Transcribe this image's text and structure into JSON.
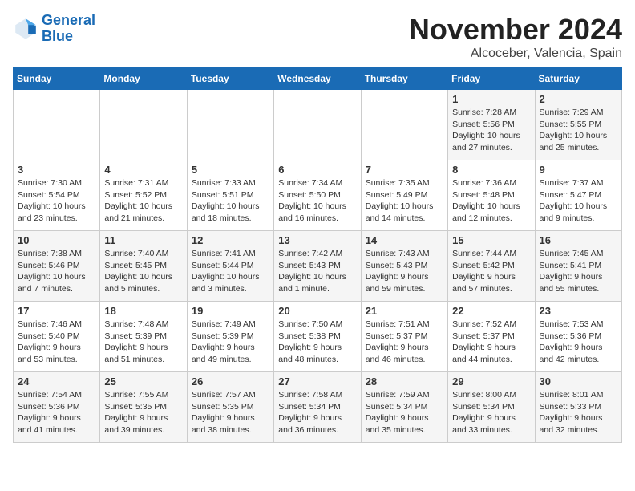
{
  "header": {
    "logo_line1": "General",
    "logo_line2": "Blue",
    "month": "November 2024",
    "location": "Alcoceber, Valencia, Spain"
  },
  "weekdays": [
    "Sunday",
    "Monday",
    "Tuesday",
    "Wednesday",
    "Thursday",
    "Friday",
    "Saturday"
  ],
  "weeks": [
    [
      {
        "day": "",
        "info": ""
      },
      {
        "day": "",
        "info": ""
      },
      {
        "day": "",
        "info": ""
      },
      {
        "day": "",
        "info": ""
      },
      {
        "day": "",
        "info": ""
      },
      {
        "day": "1",
        "info": "Sunrise: 7:28 AM\nSunset: 5:56 PM\nDaylight: 10 hours\nand 27 minutes."
      },
      {
        "day": "2",
        "info": "Sunrise: 7:29 AM\nSunset: 5:55 PM\nDaylight: 10 hours\nand 25 minutes."
      }
    ],
    [
      {
        "day": "3",
        "info": "Sunrise: 7:30 AM\nSunset: 5:54 PM\nDaylight: 10 hours\nand 23 minutes."
      },
      {
        "day": "4",
        "info": "Sunrise: 7:31 AM\nSunset: 5:52 PM\nDaylight: 10 hours\nand 21 minutes."
      },
      {
        "day": "5",
        "info": "Sunrise: 7:33 AM\nSunset: 5:51 PM\nDaylight: 10 hours\nand 18 minutes."
      },
      {
        "day": "6",
        "info": "Sunrise: 7:34 AM\nSunset: 5:50 PM\nDaylight: 10 hours\nand 16 minutes."
      },
      {
        "day": "7",
        "info": "Sunrise: 7:35 AM\nSunset: 5:49 PM\nDaylight: 10 hours\nand 14 minutes."
      },
      {
        "day": "8",
        "info": "Sunrise: 7:36 AM\nSunset: 5:48 PM\nDaylight: 10 hours\nand 12 minutes."
      },
      {
        "day": "9",
        "info": "Sunrise: 7:37 AM\nSunset: 5:47 PM\nDaylight: 10 hours\nand 9 minutes."
      }
    ],
    [
      {
        "day": "10",
        "info": "Sunrise: 7:38 AM\nSunset: 5:46 PM\nDaylight: 10 hours\nand 7 minutes."
      },
      {
        "day": "11",
        "info": "Sunrise: 7:40 AM\nSunset: 5:45 PM\nDaylight: 10 hours\nand 5 minutes."
      },
      {
        "day": "12",
        "info": "Sunrise: 7:41 AM\nSunset: 5:44 PM\nDaylight: 10 hours\nand 3 minutes."
      },
      {
        "day": "13",
        "info": "Sunrise: 7:42 AM\nSunset: 5:43 PM\nDaylight: 10 hours\nand 1 minute."
      },
      {
        "day": "14",
        "info": "Sunrise: 7:43 AM\nSunset: 5:43 PM\nDaylight: 9 hours\nand 59 minutes."
      },
      {
        "day": "15",
        "info": "Sunrise: 7:44 AM\nSunset: 5:42 PM\nDaylight: 9 hours\nand 57 minutes."
      },
      {
        "day": "16",
        "info": "Sunrise: 7:45 AM\nSunset: 5:41 PM\nDaylight: 9 hours\nand 55 minutes."
      }
    ],
    [
      {
        "day": "17",
        "info": "Sunrise: 7:46 AM\nSunset: 5:40 PM\nDaylight: 9 hours\nand 53 minutes."
      },
      {
        "day": "18",
        "info": "Sunrise: 7:48 AM\nSunset: 5:39 PM\nDaylight: 9 hours\nand 51 minutes."
      },
      {
        "day": "19",
        "info": "Sunrise: 7:49 AM\nSunset: 5:39 PM\nDaylight: 9 hours\nand 49 minutes."
      },
      {
        "day": "20",
        "info": "Sunrise: 7:50 AM\nSunset: 5:38 PM\nDaylight: 9 hours\nand 48 minutes."
      },
      {
        "day": "21",
        "info": "Sunrise: 7:51 AM\nSunset: 5:37 PM\nDaylight: 9 hours\nand 46 minutes."
      },
      {
        "day": "22",
        "info": "Sunrise: 7:52 AM\nSunset: 5:37 PM\nDaylight: 9 hours\nand 44 minutes."
      },
      {
        "day": "23",
        "info": "Sunrise: 7:53 AM\nSunset: 5:36 PM\nDaylight: 9 hours\nand 42 minutes."
      }
    ],
    [
      {
        "day": "24",
        "info": "Sunrise: 7:54 AM\nSunset: 5:36 PM\nDaylight: 9 hours\nand 41 minutes."
      },
      {
        "day": "25",
        "info": "Sunrise: 7:55 AM\nSunset: 5:35 PM\nDaylight: 9 hours\nand 39 minutes."
      },
      {
        "day": "26",
        "info": "Sunrise: 7:57 AM\nSunset: 5:35 PM\nDaylight: 9 hours\nand 38 minutes."
      },
      {
        "day": "27",
        "info": "Sunrise: 7:58 AM\nSunset: 5:34 PM\nDaylight: 9 hours\nand 36 minutes."
      },
      {
        "day": "28",
        "info": "Sunrise: 7:59 AM\nSunset: 5:34 PM\nDaylight: 9 hours\nand 35 minutes."
      },
      {
        "day": "29",
        "info": "Sunrise: 8:00 AM\nSunset: 5:34 PM\nDaylight: 9 hours\nand 33 minutes."
      },
      {
        "day": "30",
        "info": "Sunrise: 8:01 AM\nSunset: 5:33 PM\nDaylight: 9 hours\nand 32 minutes."
      }
    ]
  ]
}
